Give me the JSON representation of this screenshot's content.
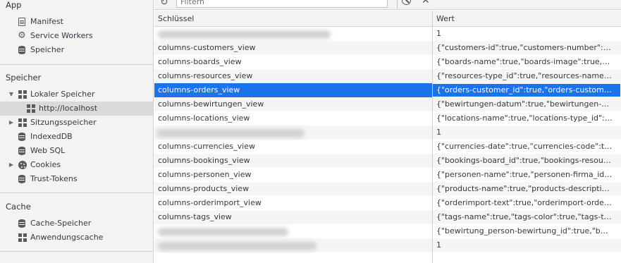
{
  "sidebar": {
    "app_title": "App",
    "app_items": [
      {
        "label": "Manifest",
        "icon": "manifest-icon"
      },
      {
        "label": "Service Workers",
        "icon": "gear-icon"
      },
      {
        "label": "Speicher",
        "icon": "database-icon"
      }
    ],
    "storage_title": "Speicher",
    "storage_items": [
      {
        "label": "Lokaler Speicher",
        "icon": "grid-icon",
        "expanded": true
      },
      {
        "label": "http://localhost",
        "icon": "grid-icon",
        "selected": true
      },
      {
        "label": "Sitzungsspeicher",
        "icon": "grid-icon",
        "expanded": false
      },
      {
        "label": "IndexedDB",
        "icon": "database-icon"
      },
      {
        "label": "Web SQL",
        "icon": "database-icon"
      },
      {
        "label": "Cookies",
        "icon": "cookie-icon",
        "expanded": false
      },
      {
        "label": "Trust-Tokens",
        "icon": "database-icon"
      }
    ],
    "cache_title": "Cache",
    "cache_items": [
      {
        "label": "Cache-Speicher",
        "icon": "database-icon"
      },
      {
        "label": "Anwendungscache",
        "icon": "grid-icon"
      }
    ]
  },
  "toolbar": {
    "filter_placeholder": "Filtern"
  },
  "table": {
    "col_key": "Schlüssel",
    "col_value": "Wert",
    "selection_color": "#1a73e8",
    "rows": [
      {
        "key": "",
        "value": "1",
        "key_redacted": true
      },
      {
        "key": "columns-customers_view",
        "value": "{\"customers-id\":true,\"customers-number\":true,\"customers-name\":true}"
      },
      {
        "key": "columns-boards_view",
        "value": "{\"boards-name\":true,\"boards-image\":true,\"boards-id\":true}"
      },
      {
        "key": "columns-resources_view",
        "value": "{\"resources-type_id\":true,\"resources-name\":true}"
      },
      {
        "key": "columns-orders_view",
        "value": "{\"orders-customer_id\":true,\"orders-customer_name\":true}",
        "selected": true
      },
      {
        "key": "columns-bewirtungen_view",
        "value": "{\"bewirtungen-datum\":true,\"bewirtungen-anlass\":true}"
      },
      {
        "key": "columns-locations_view",
        "value": "{\"locations-name\":true,\"locations-type_id\":true}"
      },
      {
        "key": "",
        "value": "1",
        "key_redacted": true
      },
      {
        "key": "columns-currencies_view",
        "value": "{\"currencies-date\":true,\"currencies-code\":true,\"currencies-rate\":true}"
      },
      {
        "key": "columns-bookings_view",
        "value": "{\"bookings-board_id\":true,\"bookings-resource_id\":true}"
      },
      {
        "key": "columns-personen_view",
        "value": "{\"personen-name\":true,\"personen-firma_id\":true}"
      },
      {
        "key": "columns-products_view",
        "value": "{\"products-name\":true,\"products-description\":true}"
      },
      {
        "key": "columns-orderimport_view",
        "value": "{\"orderimport-text\":true,\"orderimport-order_nr\":true}"
      },
      {
        "key": "columns-tags_view",
        "value": "{\"tags-name\":true,\"tags-color\":true,\"tags-text\":true}"
      },
      {
        "key": "",
        "value": "{\"bewirtung_person-bewirtung_id\":true,\"bewirtung_person-person_id\":true}",
        "key_redacted": true
      },
      {
        "key": "",
        "value": "1",
        "key_redacted": true
      }
    ]
  }
}
